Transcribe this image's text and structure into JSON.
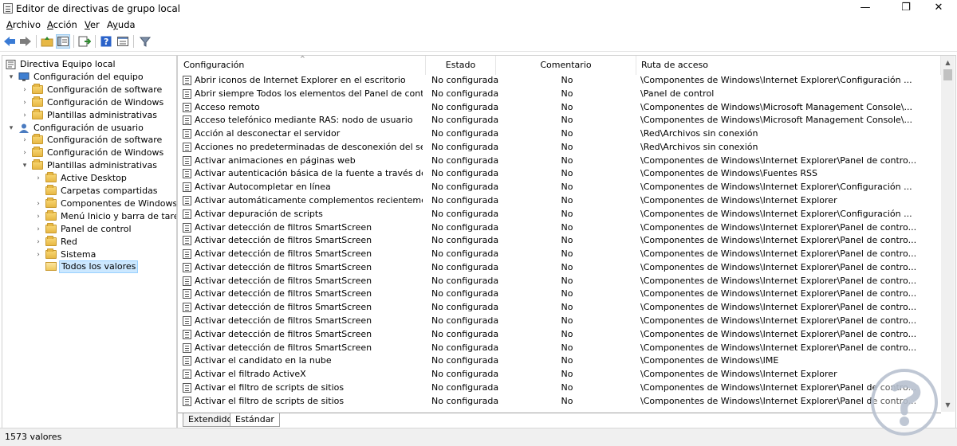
{
  "window": {
    "title": "Editor de directivas de grupo local",
    "minimize_glyph": "—",
    "maximize_glyph": "❐",
    "close_glyph": "✕"
  },
  "menu": [
    {
      "label": "Archivo",
      "accel": "A",
      "rest": "rchivo"
    },
    {
      "label": "Acción",
      "accel": "A",
      "rest": "cción"
    },
    {
      "label": "Ver",
      "accel": "V",
      "rest": "er"
    },
    {
      "label": "Ayuda",
      "accel": "y",
      "rest": "uda"
    }
  ],
  "toolbar": [
    "back-arrow-icon",
    "forward-arrow-icon",
    "up-folder-icon",
    "show-hide-tree-icon",
    "export-list-icon",
    "help-icon",
    "properties-icon",
    "filter-icon"
  ],
  "tree": [
    {
      "label": "Directiva Equipo local",
      "level": 0,
      "expander": "",
      "icon": "computer-policy-icon"
    },
    {
      "label": "Configuración del equipo",
      "level": 1,
      "expander": "▾",
      "icon": "computer-icon"
    },
    {
      "label": "Configuración de software",
      "level": 2,
      "expander": "›",
      "icon": "folder-icon"
    },
    {
      "label": "Configuración de Windows",
      "level": 2,
      "expander": "›",
      "icon": "folder-icon"
    },
    {
      "label": "Plantillas administrativas",
      "level": 2,
      "expander": "›",
      "icon": "folder-icon"
    },
    {
      "label": "Configuración de usuario",
      "level": 1,
      "expander": "▾",
      "icon": "user-icon"
    },
    {
      "label": "Configuración de software",
      "level": 2,
      "expander": "›",
      "icon": "folder-icon"
    },
    {
      "label": "Configuración de Windows",
      "level": 2,
      "expander": "›",
      "icon": "folder-icon"
    },
    {
      "label": "Plantillas administrativas",
      "level": 2,
      "expander": "▾",
      "icon": "folder-icon"
    },
    {
      "label": "Active Desktop",
      "level": 3,
      "expander": "›",
      "icon": "folder-icon"
    },
    {
      "label": "Carpetas compartidas",
      "level": 3,
      "expander": "",
      "icon": "folder-icon"
    },
    {
      "label": "Componentes de Windows",
      "level": 3,
      "expander": "›",
      "icon": "folder-icon"
    },
    {
      "label": "Menú Inicio y barra de tareas",
      "level": 3,
      "expander": "›",
      "icon": "folder-icon"
    },
    {
      "label": "Panel de control",
      "level": 3,
      "expander": "›",
      "icon": "folder-icon"
    },
    {
      "label": "Red",
      "level": 3,
      "expander": "›",
      "icon": "folder-icon"
    },
    {
      "label": "Sistema",
      "level": 3,
      "expander": "›",
      "icon": "folder-icon"
    },
    {
      "label": "Todos los valores",
      "level": 3,
      "expander": "",
      "icon": "open-folder-icon",
      "selected": true
    }
  ],
  "columns": [
    "Configuración",
    "Estado",
    "Comentario",
    "Ruta de acceso"
  ],
  "rows": [
    [
      "Abrir iconos de Internet Explorer en el escritorio",
      "No configurada",
      "No",
      "\\Componentes de Windows\\Internet Explorer\\Configuración ..."
    ],
    [
      "Abrir siempre Todos los elementos del Panel de control al a...",
      "No configurada",
      "No",
      "\\Panel de control"
    ],
    [
      "Acceso remoto",
      "No configurada",
      "No",
      "\\Componentes de Windows\\Microsoft Management Console\\..."
    ],
    [
      "Acceso telefónico mediante RAS: nodo de usuario",
      "No configurada",
      "No",
      "\\Componentes de Windows\\Microsoft Management Console\\..."
    ],
    [
      "Acción al desconectar el servidor",
      "No configurada",
      "No",
      "\\Red\\Archivos sin conexión"
    ],
    [
      "Acciones no predeterminadas de desconexión del servidor",
      "No configurada",
      "No",
      "\\Red\\Archivos sin conexión"
    ],
    [
      "Activar animaciones en páginas web",
      "No configurada",
      "No",
      "\\Componentes de Windows\\Internet Explorer\\Panel de contro..."
    ],
    [
      "Activar autenticación básica de la fuente a través de HTTP",
      "No configurada",
      "No",
      "\\Componentes de Windows\\Fuentes RSS"
    ],
    [
      "Activar Autocompletar en línea",
      "No configurada",
      "No",
      "\\Componentes de Windows\\Internet Explorer\\Configuración ..."
    ],
    [
      "Activar automáticamente complementos recientemente ins...",
      "No configurada",
      "No",
      "\\Componentes de Windows\\Internet Explorer"
    ],
    [
      "Activar depuración de scripts",
      "No configurada",
      "No",
      "\\Componentes de Windows\\Internet Explorer\\Configuración ..."
    ],
    [
      "Activar detección de filtros SmartScreen",
      "No configurada",
      "No",
      "\\Componentes de Windows\\Internet Explorer\\Panel de contro..."
    ],
    [
      "Activar detección de filtros SmartScreen",
      "No configurada",
      "No",
      "\\Componentes de Windows\\Internet Explorer\\Panel de contro..."
    ],
    [
      "Activar detección de filtros SmartScreen",
      "No configurada",
      "No",
      "\\Componentes de Windows\\Internet Explorer\\Panel de contro..."
    ],
    [
      "Activar detección de filtros SmartScreen",
      "No configurada",
      "No",
      "\\Componentes de Windows\\Internet Explorer\\Panel de contro..."
    ],
    [
      "Activar detección de filtros SmartScreen",
      "No configurada",
      "No",
      "\\Componentes de Windows\\Internet Explorer\\Panel de contro..."
    ],
    [
      "Activar detección de filtros SmartScreen",
      "No configurada",
      "No",
      "\\Componentes de Windows\\Internet Explorer\\Panel de contro..."
    ],
    [
      "Activar detección de filtros SmartScreen",
      "No configurada",
      "No",
      "\\Componentes de Windows\\Internet Explorer\\Panel de contro..."
    ],
    [
      "Activar detección de filtros SmartScreen",
      "No configurada",
      "No",
      "\\Componentes de Windows\\Internet Explorer\\Panel de contro..."
    ],
    [
      "Activar detección de filtros SmartScreen",
      "No configurada",
      "No",
      "\\Componentes de Windows\\Internet Explorer\\Panel de contro..."
    ],
    [
      "Activar detección de filtros SmartScreen",
      "No configurada",
      "No",
      "\\Componentes de Windows\\Internet Explorer\\Panel de contro..."
    ],
    [
      "Activar el candidato en la nube",
      "No configurada",
      "No",
      "\\Componentes de Windows\\IME"
    ],
    [
      "Activar el filtrado ActiveX",
      "No configurada",
      "No",
      "\\Componentes de Windows\\Internet Explorer"
    ],
    [
      "Activar el filtro de scripts de sitios",
      "No configurada",
      "No",
      "\\Componentes de Windows\\Internet Explorer\\Panel de contro..."
    ],
    [
      "Activar el filtro de scripts de sitios",
      "No configurada",
      "No",
      "\\Componentes de Windows\\Internet Explorer\\Panel de contro..."
    ]
  ],
  "tabs": [
    "Extendido",
    "Estándar"
  ],
  "status": {
    "text": "1573 valores"
  },
  "colors": {
    "selection": "#cce8ff",
    "statusbar": "#f0f0f0",
    "folder": "#e7b845"
  }
}
